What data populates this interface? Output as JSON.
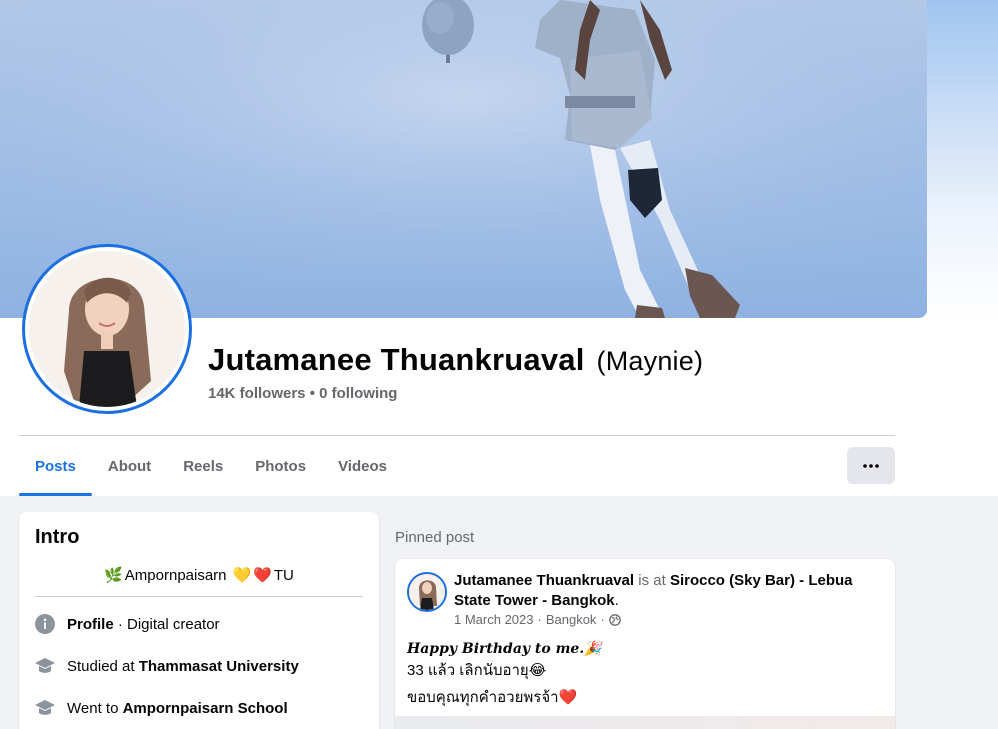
{
  "profile": {
    "name": "Jutamanee Thuankruaval",
    "alternate_name": "(Maynie)",
    "followers_text": "14K followers • 0 following"
  },
  "tabs": [
    {
      "label": "Posts",
      "active": true
    },
    {
      "label": "About",
      "active": false
    },
    {
      "label": "Reels",
      "active": false
    },
    {
      "label": "Photos",
      "active": false
    },
    {
      "label": "Videos",
      "active": false
    }
  ],
  "more_button": {
    "icon": "ellipsis-icon",
    "label": "•••"
  },
  "intro": {
    "title": "Intro",
    "bio": {
      "leaf_emoji": "🌿",
      "text1": "Ampornpaisarn",
      "heart_yellow": "💛",
      "heart_red": "❤️",
      "text2": "TU"
    },
    "rows": [
      {
        "icon": "info-icon",
        "bold": "Profile",
        "text": " · Digital creator",
        "bold_first": true
      },
      {
        "icon": "graduation-cap-icon",
        "text": "Studied at ",
        "bold": "Thammasat University",
        "bold_first": false
      },
      {
        "icon": "graduation-cap-icon",
        "text": "Went to ",
        "bold": "Ampornpaisarn School",
        "bold_first": false
      }
    ]
  },
  "pinned": {
    "label": "Pinned post",
    "post": {
      "author": "Jutamanee Thuankruaval",
      "is_at": " is at ",
      "place": "Sirocco (Sky Bar) - Lebua State Tower - Bangkok",
      "period": ".",
      "date": "1 March 2023",
      "location": "Bangkok",
      "sep": "·",
      "audience_icon": "globe-icon",
      "line1": "𝑯𝒂𝒑𝒑𝒚 𝑩𝒊𝒓𝒕𝒉𝒅𝒂𝒚 𝒕𝒐 𝒎𝒆.🎉",
      "line2": "33 แล้ว เลิกนับอายุ😂",
      "line3": "ขอบคุณทุกคำอวยพรจ้า❤️"
    }
  },
  "colors": {
    "accent": "#1b74e4",
    "avatar_ring": "#1b6fe0",
    "secondary_text": "#65676b",
    "background": "#f0f2f5"
  }
}
